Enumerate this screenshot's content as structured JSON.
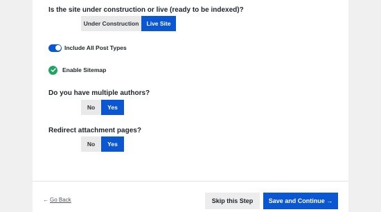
{
  "site_status": {
    "question": "Is the site under construction or live (ready to be indexed)?",
    "options": [
      "Under Construction",
      "Live Site"
    ],
    "selected": "Live Site"
  },
  "post_types": {
    "label": "Include All Post Types",
    "enabled": true
  },
  "sitemap": {
    "label": "Enable Sitemap",
    "checked": true
  },
  "multiple_authors": {
    "question": "Do you have multiple authors?",
    "options": [
      "No",
      "Yes"
    ],
    "selected": "Yes"
  },
  "redirect_attachments": {
    "question": "Redirect attachment pages?",
    "options": [
      "No",
      "Yes"
    ],
    "selected": "Yes"
  },
  "footer": {
    "back_arrow": "←",
    "back_label": "Go Back",
    "skip_label": "Skip this Step",
    "continue_label": "Save and Continue →"
  },
  "colors": {
    "accent": "#0b56d1",
    "success": "#1fa463",
    "page_background": "#f0f0f1",
    "panel_background": "#ffffff"
  },
  "icons": {
    "toggle": "toggle-on-icon",
    "check": "check-circle-icon",
    "back": "arrow-left-icon"
  }
}
